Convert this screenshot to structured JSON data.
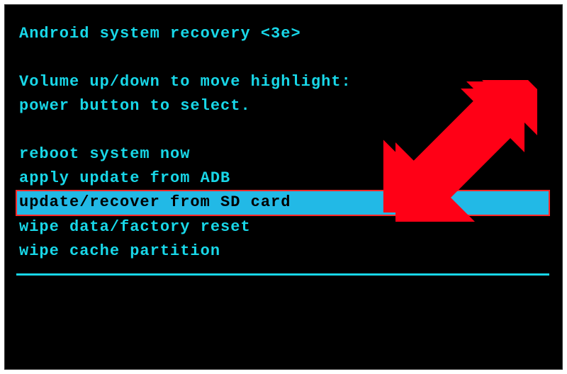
{
  "header": {
    "title": "Android system recovery <3e>"
  },
  "instructions": {
    "line1": "Volume up/down to move highlight:",
    "line2": "power button to select."
  },
  "menu": {
    "items": [
      {
        "label": "reboot system now",
        "selected": false
      },
      {
        "label": "apply update from ADB",
        "selected": false
      },
      {
        "label": "update/recover from SD card",
        "selected": true
      },
      {
        "label": "wipe data/factory reset",
        "selected": false
      },
      {
        "label": "wipe cache partition",
        "selected": false
      }
    ]
  },
  "annotation": {
    "arrow_color": "#ff0016"
  }
}
